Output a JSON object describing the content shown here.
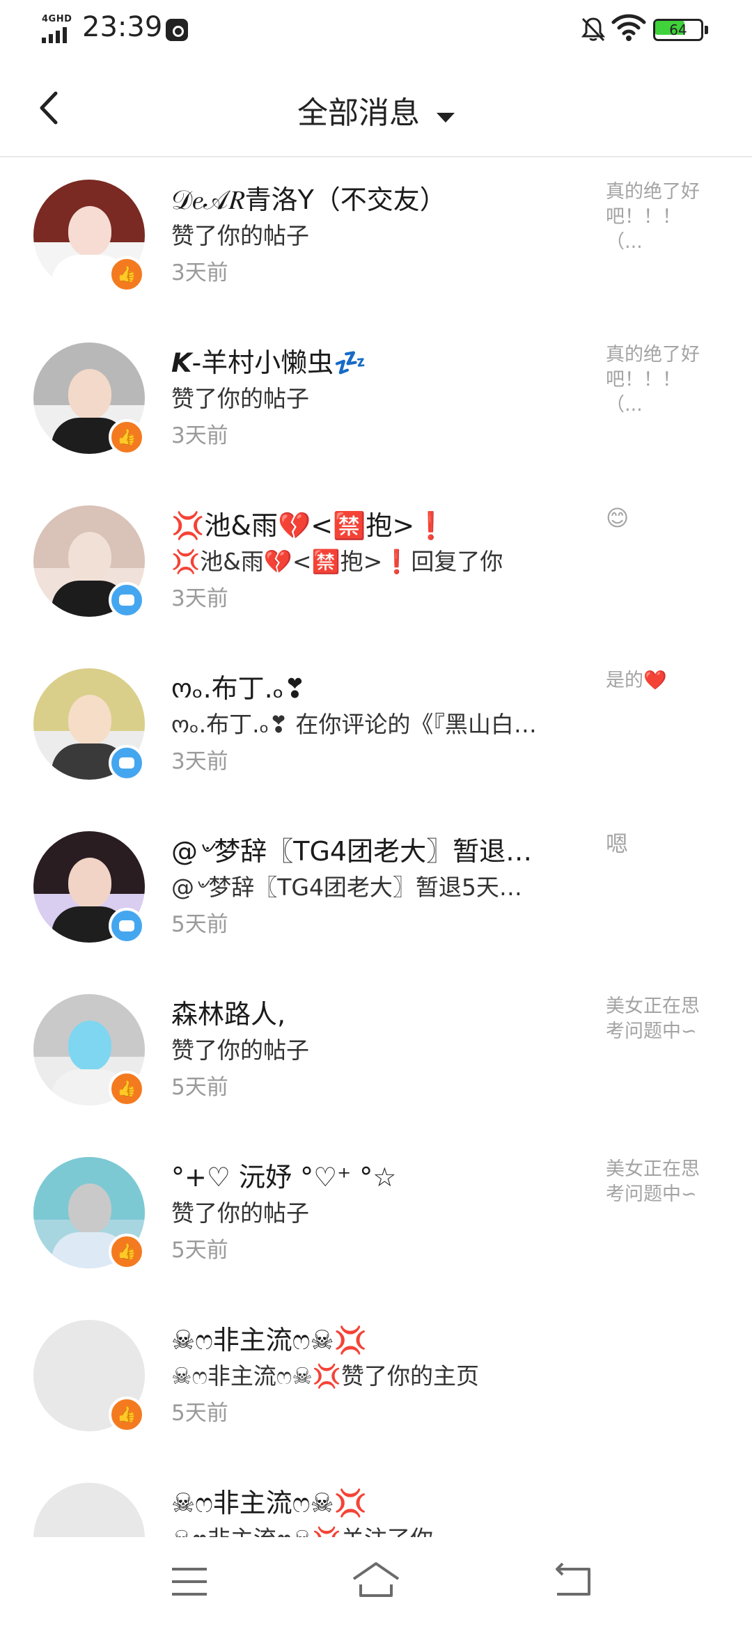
{
  "status_bar": {
    "network": "4GHD",
    "time": "23:39",
    "battery_level": 64,
    "battery_text": "64"
  },
  "header": {
    "title": "全部消息"
  },
  "messages": [
    {
      "name": "𝒟𝑒𝒜𝑅青洛Y（不交友）",
      "action": "赞了你的帖子",
      "time": "3天前",
      "preview": "真的绝了好吧！！！（...",
      "type": "like",
      "avatar_hair": "#7a2a22",
      "avatar_skin": "#f6dcd3",
      "avatar_body": "#ffffff",
      "avatar_bg": "#f4f4f4"
    },
    {
      "name": "𝙆-羊村小懒虫💤",
      "action": "赞了你的帖子",
      "time": "3天前",
      "preview": "真的绝了好吧！！！（...",
      "type": "like",
      "avatar_hair": "#b8b8b8",
      "avatar_skin": "#f3d9c9",
      "avatar_body": "#1d1d1d",
      "avatar_bg": "#efefef"
    },
    {
      "name": "💢池&雨💔<🈲抱>❗",
      "action": "💢池&雨💔<🈲抱>❗回复了你",
      "time": "3天前",
      "preview": "😊",
      "type": "comment",
      "avatar_hair": "#d9c2b8",
      "avatar_skin": "#f1e0d6",
      "avatar_body": "#1c1c1c",
      "avatar_bg": "#f0e2da"
    },
    {
      "name": "ოₒ.布丁.ₒ❣",
      "action": "ოₒ.布丁.ₒ❣ 在你评论的《『黑山白…",
      "time": "3天前",
      "preview": "是的❤️",
      "type": "comment",
      "avatar_hair": "#d9cf8a",
      "avatar_skin": "#f6ddc8",
      "avatar_body": "#3a3a3a",
      "avatar_bg": "#ececec"
    },
    {
      "name": "@৺梦辞〖TG4团老大〗暂退…",
      "action": "@৺梦辞〖TG4团老大〗暂退5天…",
      "time": "5天前",
      "preview": "嗯",
      "type": "comment",
      "avatar_hair": "#2a1d22",
      "avatar_skin": "#f1d4c6",
      "avatar_body": "#1e1e1e",
      "avatar_bg": "#d9cdf0"
    },
    {
      "name": "森林路人,",
      "action": "赞了你的帖子",
      "time": "5天前",
      "preview": "美女正在思考问题中∽",
      "type": "like",
      "avatar_hair": "#c9c9c9",
      "avatar_skin": "#7fd6f0",
      "avatar_body": "#f2f2f2",
      "avatar_bg": "#ececec"
    },
    {
      "name": "°+♡ 沅妤 °♡⁺ °☆",
      "action": "赞了你的帖子",
      "time": "5天前",
      "preview": "美女正在思考问题中∽",
      "type": "like",
      "avatar_hair": "#7cc9d4",
      "avatar_skin": "#c9c9c9",
      "avatar_body": "#dde9f4",
      "avatar_bg": "#a8d6e0"
    },
    {
      "name": "☠ෆ非主流ෆ☠💢",
      "action": "☠ෆ非主流ෆ☠💢赞了你的主页",
      "time": "5天前",
      "preview": "",
      "type": "like",
      "avatar_hair": "#e8e8e8",
      "avatar_skin": "#e8e8e8",
      "avatar_body": "#e8e8e8",
      "avatar_bg": "#e8e8e8"
    },
    {
      "name": "☠ෆ非主流ෆ☠💢",
      "action": "☠ෆ非主流ෆ☠💢关注了你",
      "time": "",
      "preview": "",
      "type": "none",
      "avatar_hair": "#e8e8e8",
      "avatar_skin": "#e8e8e8",
      "avatar_body": "#e8e8e8",
      "avatar_bg": "#e8e8e8"
    }
  ],
  "colors": {
    "like_badge": "#f47a20",
    "comment_badge": "#45a6f0",
    "battery_fill": "#3fd23a"
  },
  "nav": {
    "menu_icon": "menu-lines-icon",
    "home_icon": "home-icon",
    "back_icon": "return-icon"
  }
}
